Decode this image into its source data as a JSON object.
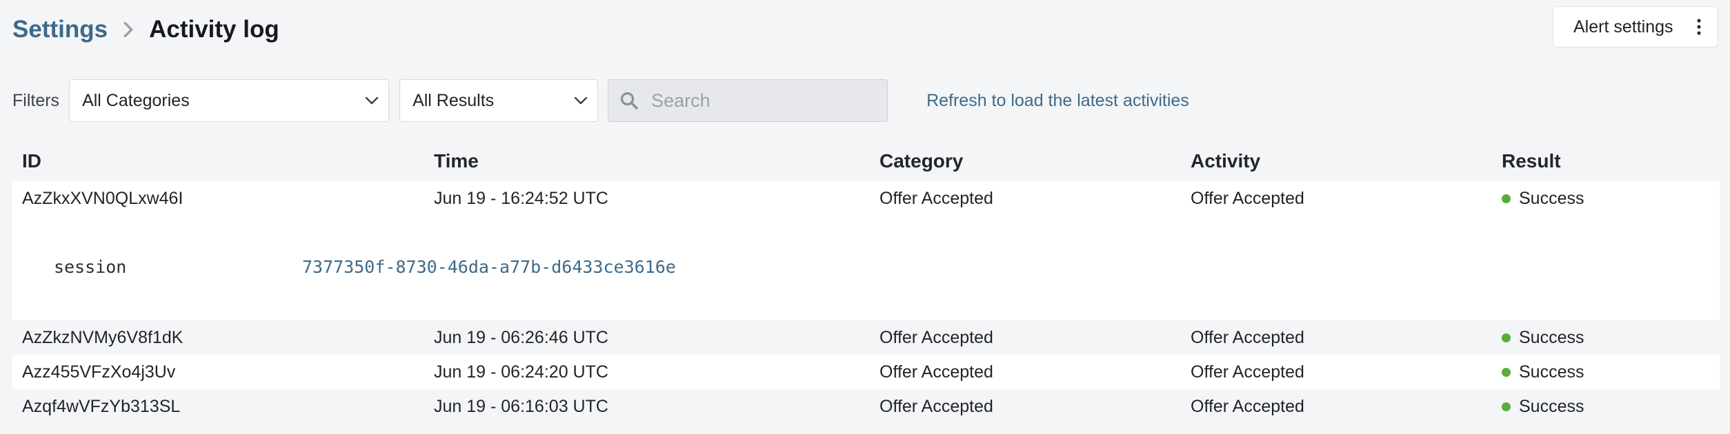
{
  "breadcrumb": {
    "parent": "Settings",
    "current": "Activity log"
  },
  "header": {
    "alert_settings_label": "Alert settings"
  },
  "filters": {
    "label": "Filters",
    "category_selected": "All Categories",
    "result_selected": "All Results",
    "search_placeholder": "Search",
    "refresh_text": "Refresh to load the latest activities"
  },
  "table": {
    "columns": [
      "ID",
      "Time",
      "Category",
      "Activity",
      "Result"
    ],
    "rows": [
      {
        "id": "AzZkxXVN0QLxw46I",
        "time": "Jun 19 - 16:24:52 UTC",
        "category": "Offer Accepted",
        "activity": "Offer Accepted",
        "result": "Success"
      },
      {
        "id": "AzZkzNVMy6V8f1dK",
        "time": "Jun 19 - 06:26:46 UTC",
        "category": "Offer Accepted",
        "activity": "Offer Accepted",
        "result": "Success"
      },
      {
        "id": "Azz455VFzXo4j3Uv",
        "time": "Jun 19 - 06:24:20 UTC",
        "category": "Offer Accepted",
        "activity": "Offer Accepted",
        "result": "Success"
      },
      {
        "id": "Azqf4wVFzYb313SL",
        "time": "Jun 19 - 06:16:03 UTC",
        "category": "Offer Accepted",
        "activity": "Offer Accepted",
        "result": "Success"
      }
    ],
    "expanded_detail": {
      "key": "session",
      "value": "7377350f-8730-46da-a77b-d6433ce3616e"
    }
  },
  "colors": {
    "link": "#3d6a8a",
    "success": "#5bab3c",
    "background": "#f4f5f7"
  },
  "icons": {
    "breadcrumb_separator": "chevron-right-icon",
    "alert_menu": "kebab-menu-icon",
    "select_arrow": "chevron-down-icon",
    "search": "search-icon"
  }
}
